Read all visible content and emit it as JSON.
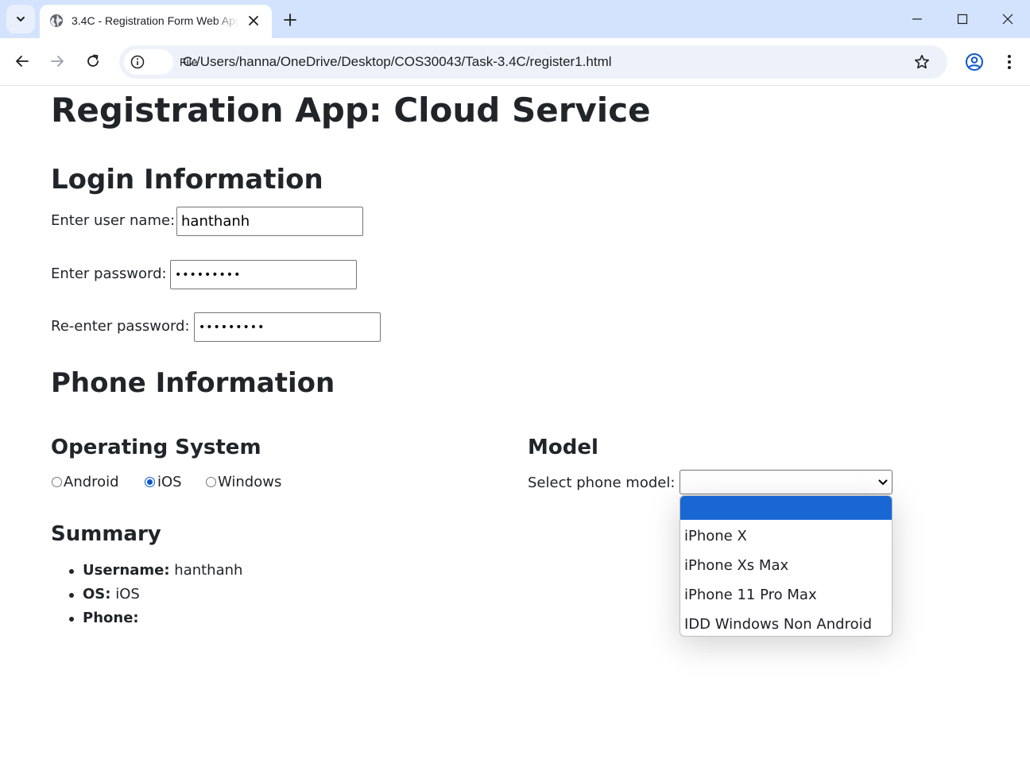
{
  "browser": {
    "tab_title": "3.4C - Registration Form Web App",
    "chip_label": "File",
    "url": "C:/Users/hanna/OneDrive/Desktop/COS30043/Task-3.4C/register1.html"
  },
  "page": {
    "title": "Registration App: Cloud Service",
    "login_heading": "Login Information",
    "username_label": "Enter user name:",
    "username_value": "hanthanh",
    "password_label": "Enter password:",
    "password_value": "•••••••••",
    "repassword_label": "Re-enter password:",
    "repassword_value": "•••••••••",
    "phone_heading": "Phone Information",
    "os_heading": "Operating System",
    "os_options": [
      "Android",
      "iOS",
      "Windows"
    ],
    "os_selected": "iOS",
    "model_heading": "Model",
    "model_label": "Select phone model:",
    "model_selected": "",
    "model_options": [
      "",
      "iPhone X",
      "iPhone Xs Max",
      "iPhone 11 Pro Max",
      "IDD Windows Non Android"
    ],
    "summary_heading": "Summary",
    "summary": {
      "username_key": "Username:",
      "username_val": "hanthanh",
      "os_key": "OS:",
      "os_val": "iOS",
      "phone_key": "Phone:",
      "phone_val": ""
    }
  },
  "colors": {
    "tabbar": "#d3e3fd",
    "accent": "#0b57d0",
    "option_highlight": "#1967d2"
  }
}
